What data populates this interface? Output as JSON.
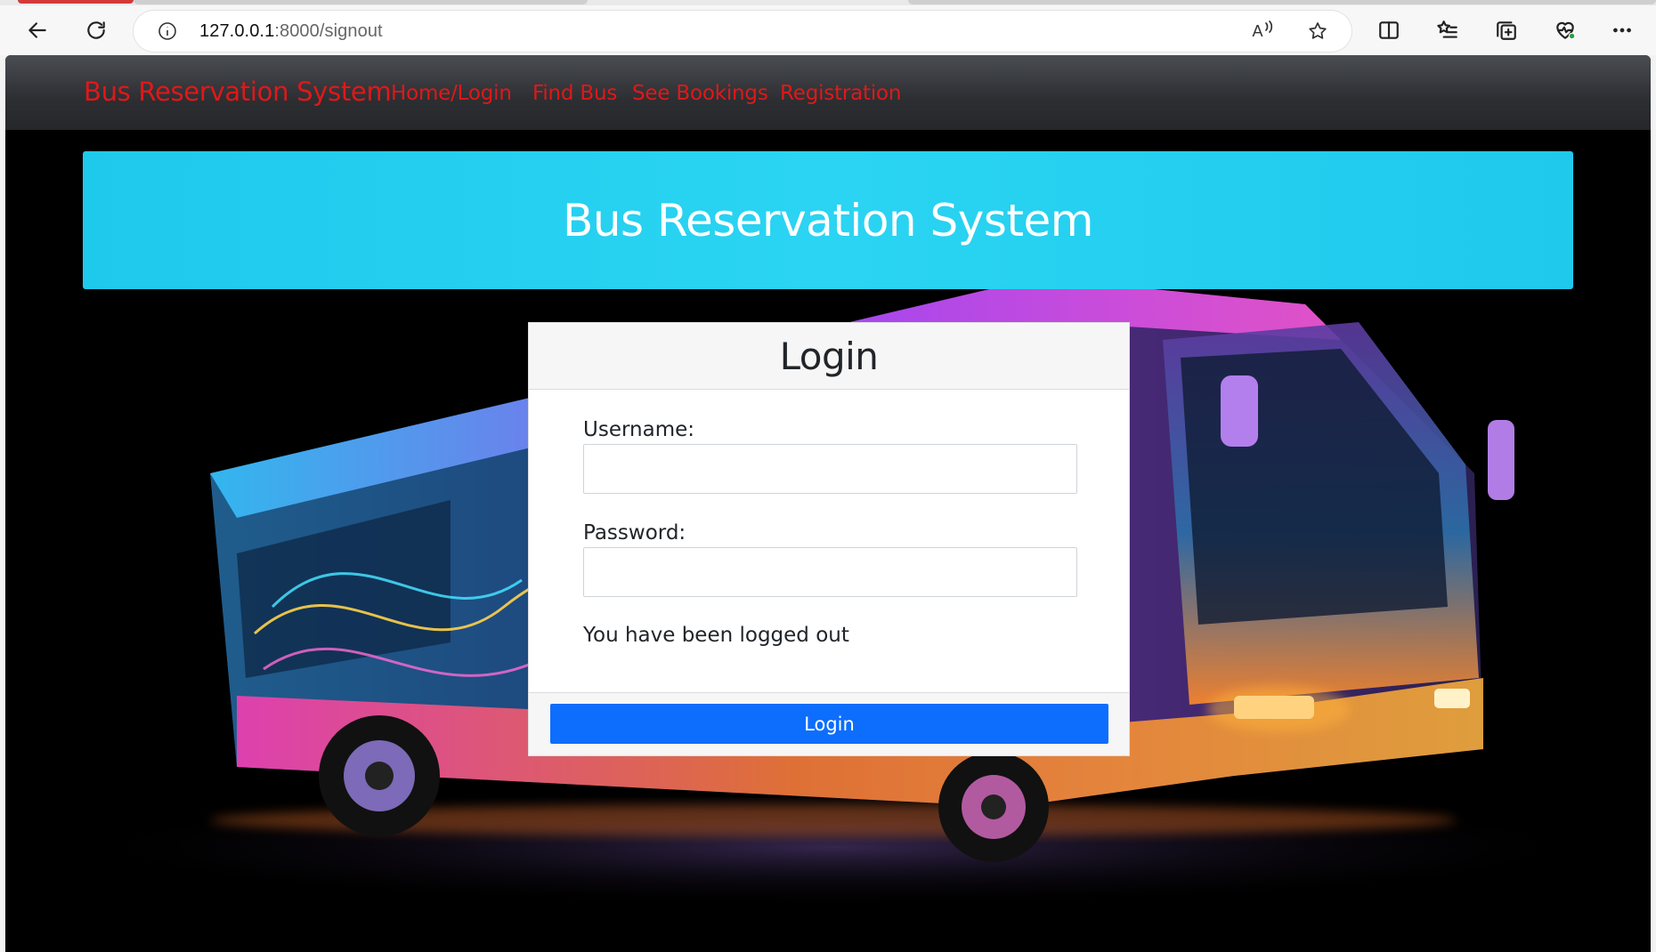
{
  "browser": {
    "url_host": "127.0.0.1",
    "url_path": ":8000/signout",
    "read_aloud_label": "A"
  },
  "navbar": {
    "brand": "Bus Reservation System",
    "links": [
      {
        "label": "Home/Login"
      },
      {
        "label": "Find Bus"
      },
      {
        "label": "See Bookings"
      },
      {
        "label": "Registration"
      }
    ],
    "link_color": "#e01818"
  },
  "hero": {
    "title": "Bus Reservation System",
    "color": "#22cdef"
  },
  "login_card": {
    "title": "Login",
    "username_label": "Username:",
    "username_value": "",
    "password_label": "Password:",
    "password_value": "",
    "message": "You have been logged out",
    "submit_label": "Login",
    "button_color": "#0d6efd"
  }
}
